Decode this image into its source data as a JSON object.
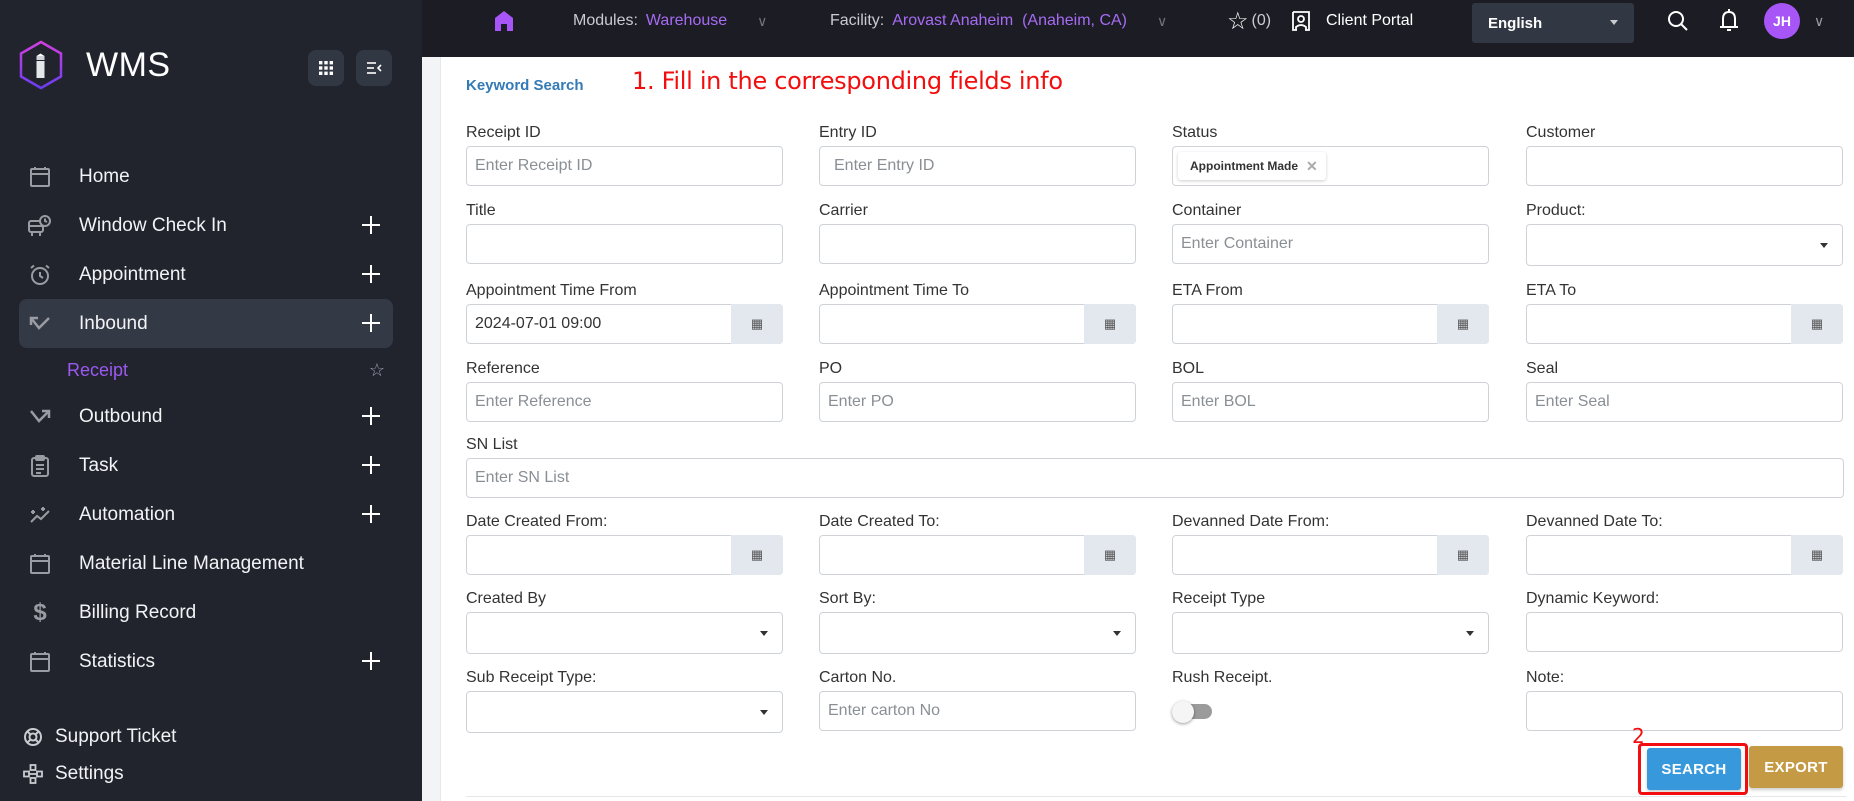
{
  "brand": {
    "name": "WMS",
    "logo_icon": "hexagon-i-logo",
    "apps_icon": "grid-icon",
    "collapse_icon": "collapse-menu-icon"
  },
  "topbar": {
    "home_icon": "home-icon",
    "modules_label": "Modules:",
    "modules_value": "Warehouse",
    "facility_label": "Facility:",
    "facility_value": "Arovast Anaheim  (Anaheim, CA)",
    "favorites_count": "(0)",
    "client_portal": "Client Portal",
    "language": "English",
    "user_initials": "JH",
    "accent_color": "#a66bf3"
  },
  "sidebar": {
    "items": [
      {
        "label": "Home",
        "icon": "calendar-icon",
        "expandable": false
      },
      {
        "label": "Window Check In",
        "icon": "truck-clock-icon",
        "expandable": true
      },
      {
        "label": "Appointment",
        "icon": "alarm-clock-icon",
        "expandable": true
      },
      {
        "label": "Inbound",
        "icon": "inbound-arrow-icon",
        "expandable": true,
        "active": true
      },
      {
        "label": "Outbound",
        "icon": "outbound-arrow-icon",
        "expandable": true
      },
      {
        "label": "Task",
        "icon": "clipboard-icon",
        "expandable": true
      },
      {
        "label": "Automation",
        "icon": "sparkle-chart-icon",
        "expandable": true
      },
      {
        "label": "Material Line Management",
        "icon": "calendar-icon",
        "expandable": false
      },
      {
        "label": "Billing Record",
        "icon": "dollar-icon",
        "expandable": false
      },
      {
        "label": "Statistics",
        "icon": "calendar-icon",
        "expandable": true
      }
    ],
    "sub_items": [
      {
        "label": "Receipt",
        "parent": "Inbound"
      }
    ],
    "bottom": [
      {
        "label": "Support Ticket",
        "icon": "lifebuoy-icon"
      },
      {
        "label": "Settings",
        "icon": "settings-nodes-icon"
      }
    ]
  },
  "main": {
    "section_title": "Keyword Search",
    "annotation_1": "1. Fill in the corresponding fields info",
    "annotation_2": "2",
    "fields": {
      "receipt_id": {
        "label": "Receipt ID",
        "placeholder": "Enter Receipt ID",
        "value": ""
      },
      "entry_id": {
        "label": "Entry ID",
        "placeholder": "Enter Entry ID",
        "value": ""
      },
      "status": {
        "label": "Status",
        "tags": [
          "Appointment Made"
        ]
      },
      "customer": {
        "label": "Customer",
        "value": ""
      },
      "title": {
        "label": "Title",
        "value": ""
      },
      "carrier": {
        "label": "Carrier",
        "value": ""
      },
      "container": {
        "label": "Container",
        "placeholder": "Enter Container",
        "value": ""
      },
      "product": {
        "label": "Product:",
        "value": ""
      },
      "appt_from": {
        "label": "Appointment Time From",
        "value": "2024-07-01 09:00"
      },
      "appt_to": {
        "label": "Appointment Time To",
        "value": ""
      },
      "eta_from": {
        "label": "ETA From",
        "value": ""
      },
      "eta_to": {
        "label": "ETA To",
        "value": ""
      },
      "reference": {
        "label": "Reference",
        "placeholder": "Enter Reference",
        "value": ""
      },
      "po": {
        "label": "PO",
        "placeholder": "Enter PO",
        "value": ""
      },
      "bol": {
        "label": "BOL",
        "placeholder": "Enter BOL",
        "value": ""
      },
      "seal": {
        "label": "Seal",
        "placeholder": "Enter Seal",
        "value": ""
      },
      "sn_list": {
        "label": "SN List",
        "placeholder": "Enter SN List",
        "value": ""
      },
      "date_created_from": {
        "label": "Date Created From:",
        "value": ""
      },
      "date_created_to": {
        "label": "Date Created To:",
        "value": ""
      },
      "devanned_from": {
        "label": "Devanned Date From:",
        "value": ""
      },
      "devanned_to": {
        "label": "Devanned Date To:",
        "value": ""
      },
      "created_by": {
        "label": "Created By",
        "value": ""
      },
      "sort_by": {
        "label": "Sort By:",
        "value": ""
      },
      "receipt_type": {
        "label": "Receipt Type",
        "value": ""
      },
      "dynamic_keyword": {
        "label": "Dynamic Keyword:",
        "value": ""
      },
      "sub_receipt_type": {
        "label": "Sub Receipt Type:",
        "value": ""
      },
      "carton_no": {
        "label": "Carton No.",
        "placeholder": "Enter carton No",
        "value": ""
      },
      "rush_receipt": {
        "label": "Rush Receipt.",
        "checked": false
      },
      "note": {
        "label": "Note:",
        "value": ""
      }
    },
    "buttons": {
      "search": "SEARCH",
      "export": "EXPORT"
    },
    "colors": {
      "search": "#3799dc",
      "export": "#c49a45",
      "annotation": "#f20e0e",
      "section_title": "#337ab7"
    }
  }
}
